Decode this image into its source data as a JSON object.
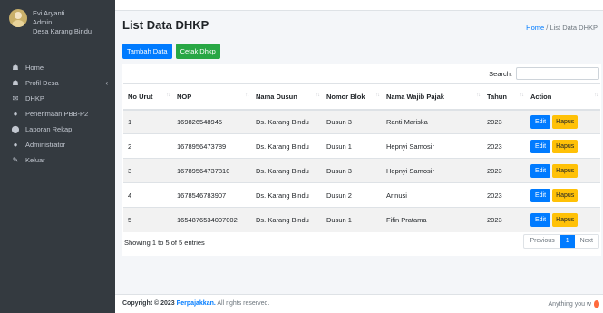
{
  "user": {
    "name": "Evi Aryanti",
    "role": "Admin",
    "desa": "Desa Karang Bindu"
  },
  "sidebar": {
    "items": [
      {
        "label": "Home",
        "icon": "home-icon"
      },
      {
        "label": "Profil Desa",
        "icon": "home-icon",
        "chevron": "‹"
      },
      {
        "label": "DHKP",
        "icon": "envelope-icon"
      },
      {
        "label": "Penerimaan PBB-P2",
        "icon": "user-icon"
      },
      {
        "label": "Laporan Rekap",
        "icon": "circle-icon"
      },
      {
        "label": "Administrator",
        "icon": "user-icon"
      },
      {
        "label": "Keluar",
        "icon": "pen-icon"
      }
    ]
  },
  "page": {
    "title": "List Data DHKP"
  },
  "breadcrumb": {
    "home": "Home",
    "sep": "/",
    "current": "List Data DHKP"
  },
  "toolbar": {
    "add_label": "Tambah Data",
    "print_label": "Cetak Dhkp"
  },
  "search": {
    "label": "Search:",
    "value": ""
  },
  "table": {
    "headers": [
      "No Urut",
      "NOP",
      "Nama Dusun",
      "Nomor Blok",
      "Nama Wajib Pajak",
      "Tahun",
      "Action"
    ],
    "rows": [
      [
        "1",
        "169826548945",
        "Ds. Karang Bindu",
        "Dusun 3",
        "Ranti Mariska",
        "2023"
      ],
      [
        "2",
        "1678956473789",
        "Ds. Karang Bindu",
        "Dusun 1",
        "Hepnyi Samosir",
        "2023"
      ],
      [
        "3",
        "16789564737810",
        "Ds. Karang Bindu",
        "Dusun 3",
        "Hepnyi Samosir",
        "2023"
      ],
      [
        "4",
        "1678546783907",
        "Ds. Karang Bindu",
        "Dusun 2",
        "Arinusi",
        "2023"
      ],
      [
        "5",
        "1654876534007002",
        "Ds. Karang Bindu",
        "Dusun 1",
        "Fifin Pratama",
        "2023"
      ]
    ],
    "edit_label": "Edit",
    "delete_label": "Hapus"
  },
  "pagination": {
    "info": "Showing 1 to 5 of 5 entries",
    "previous": "Previous",
    "current": "1",
    "next": "Next"
  },
  "footer": {
    "copyright": "Copyright © 2023",
    "brand": "Perpajakkan.",
    "rights": "All rights reserved.",
    "right_text": "Anything you w"
  },
  "colors": {
    "primary": "#007bff",
    "success": "#28a745",
    "warning": "#ffc107",
    "sidebar": "#343a40"
  }
}
